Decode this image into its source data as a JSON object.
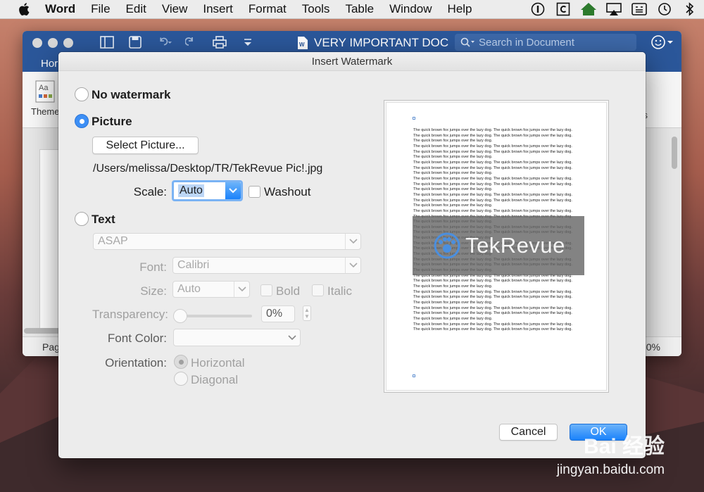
{
  "menubar": {
    "app": "Word",
    "items": [
      "File",
      "Edit",
      "View",
      "Insert",
      "Format",
      "Tools",
      "Table",
      "Window",
      "Help"
    ],
    "right_icons": [
      "accessibility-icon",
      "c-icon",
      "home-icon",
      "airplay-icon",
      "keyboard-icon",
      "time-machine-icon",
      "bluetooth-icon"
    ]
  },
  "window": {
    "doc_title": "VERY IMPORTANT DOC",
    "search_placeholder": "Search in Document",
    "ribbon_tab": "Hor",
    "ribbon_themes": "Theme",
    "status_left": "Pag",
    "status_zoom": "0%",
    "ribbon_right_fragment": "s"
  },
  "dialog": {
    "title": "Insert Watermark",
    "no_watermark_label": "No watermark",
    "picture_label": "Picture",
    "select_picture_button": "Select Picture...",
    "picture_path": "/Users/melissa/Desktop/TR/TekRevue Pic!.jpg",
    "scale_label": "Scale:",
    "scale_value": "Auto",
    "washout_label": "Washout",
    "text_label": "Text",
    "text_value": "ASAP",
    "font_label": "Font:",
    "font_value": "Calibri",
    "size_label": "Size:",
    "size_value": "Auto",
    "bold_label": "Bold",
    "italic_label": "Italic",
    "transparency_label": "Transparency:",
    "transparency_value": "0%",
    "font_color_label": "Font Color:",
    "orientation_label": "Orientation:",
    "horizontal_label": "Horizontal",
    "diagonal_label": "Diagonal",
    "cancel_button": "Cancel",
    "ok_button": "OK",
    "selected_option": "picture",
    "selected_orientation": "horizontal",
    "preview_line": "The quick brown fox jumps over the lazy dog.  The quick brown fox jumps over the lazy dog.",
    "watermark_text": "TekRevue"
  },
  "overlay": {
    "brand": "Bai 经验",
    "url": "jingyan.baidu.com"
  },
  "colors": {
    "word_blue": "#2b579a",
    "accent_blue": "#1a82fb"
  }
}
